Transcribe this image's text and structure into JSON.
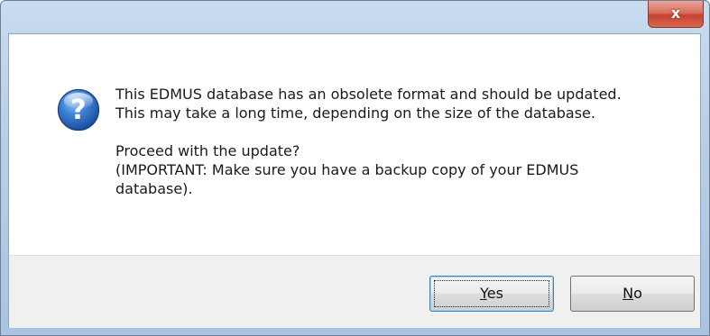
{
  "window": {
    "close_glyph": "x"
  },
  "icon": {
    "name": "question-icon",
    "glyph": "?",
    "color": "#2f6fc9"
  },
  "message": {
    "line1": "This EDMUS database has an obsolete format and should be updated.",
    "line2": "This may take a long time, depending on the size of the database.",
    "line3": "Proceed with the update?",
    "line4": "(IMPORTANT: Make sure you have a backup copy of your EDMUS",
    "line5": "database)."
  },
  "buttons": {
    "yes": {
      "accel": "Y",
      "rest": "es"
    },
    "no": {
      "accel": "N",
      "rest": "o"
    }
  }
}
